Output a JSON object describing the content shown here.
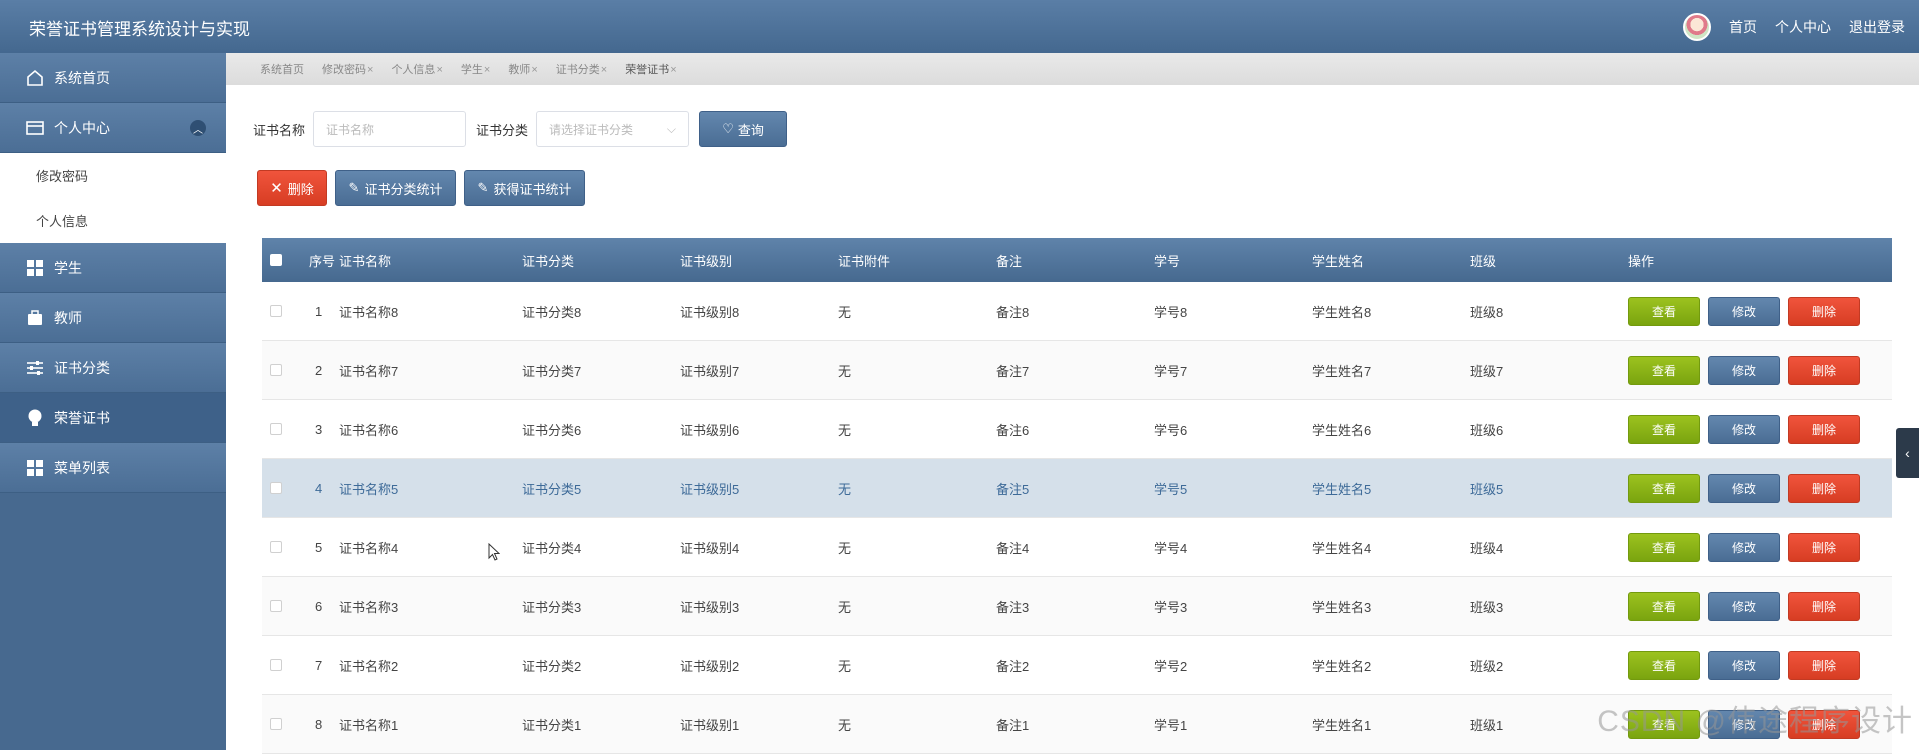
{
  "header": {
    "title": "荣誉证书管理系统设计与实现",
    "links": [
      "首页",
      "个人中心",
      "退出登录"
    ]
  },
  "sidebar": {
    "items": [
      {
        "label": "系统首页",
        "icon": "home-icon"
      },
      {
        "label": "个人中心",
        "icon": "wallet-icon",
        "expanded": true,
        "children": [
          "修改密码",
          "个人信息"
        ]
      },
      {
        "label": "学生",
        "icon": "grid-icon"
      },
      {
        "label": "教师",
        "icon": "briefcase-icon"
      },
      {
        "label": "证书分类",
        "icon": "sliders-icon"
      },
      {
        "label": "荣誉证书",
        "icon": "bulb-icon",
        "active": true
      },
      {
        "label": "菜单列表",
        "icon": "grid-icon"
      }
    ]
  },
  "tabs": [
    {
      "label": "系统首页",
      "closable": false
    },
    {
      "label": "修改密码",
      "closable": true
    },
    {
      "label": "个人信息",
      "closable": true
    },
    {
      "label": "学生",
      "closable": true
    },
    {
      "label": "教师",
      "closable": true
    },
    {
      "label": "证书分类",
      "closable": true
    },
    {
      "label": "荣誉证书",
      "closable": true,
      "active": true
    }
  ],
  "search": {
    "name_label": "证书名称",
    "name_placeholder": "证书名称",
    "category_label": "证书分类",
    "category_placeholder": "请选择证书分类",
    "query_label": "查询"
  },
  "toolbar": {
    "delete_label": "删除",
    "stat1_label": "证书分类统计",
    "stat2_label": "获得证书统计"
  },
  "table": {
    "columns": [
      "序号",
      "证书名称",
      "证书分类",
      "证书级别",
      "证书附件",
      "备注",
      "学号",
      "学生姓名",
      "班级",
      "操作"
    ],
    "rows": [
      [
        "1",
        "证书名称8",
        "证书分类8",
        "证书级别8",
        "无",
        "备注8",
        "学号8",
        "学生姓名8",
        "班级8"
      ],
      [
        "2",
        "证书名称7",
        "证书分类7",
        "证书级别7",
        "无",
        "备注7",
        "学号7",
        "学生姓名7",
        "班级7"
      ],
      [
        "3",
        "证书名称6",
        "证书分类6",
        "证书级别6",
        "无",
        "备注6",
        "学号6",
        "学生姓名6",
        "班级6"
      ],
      [
        "4",
        "证书名称5",
        "证书分类5",
        "证书级别5",
        "无",
        "备注5",
        "学号5",
        "学生姓名5",
        "班级5"
      ],
      [
        "5",
        "证书名称4",
        "证书分类4",
        "证书级别4",
        "无",
        "备注4",
        "学号4",
        "学生姓名4",
        "班级4"
      ],
      [
        "6",
        "证书名称3",
        "证书分类3",
        "证书级别3",
        "无",
        "备注3",
        "学号3",
        "学生姓名3",
        "班级3"
      ],
      [
        "7",
        "证书名称2",
        "证书分类2",
        "证书级别2",
        "无",
        "备注2",
        "学号2",
        "学生姓名2",
        "班级2"
      ],
      [
        "8",
        "证书名称1",
        "证书分类1",
        "证书级别1",
        "无",
        "备注1",
        "学号1",
        "学生姓名1",
        "班级1"
      ]
    ],
    "highlighted_row": 3,
    "actions": [
      "查看",
      "修改",
      "删除"
    ]
  },
  "watermark": "CSDN @伟途程序设计",
  "colors": {
    "primary": "#4a6d94",
    "danger": "#d73d23",
    "success": "#7aa40f"
  }
}
